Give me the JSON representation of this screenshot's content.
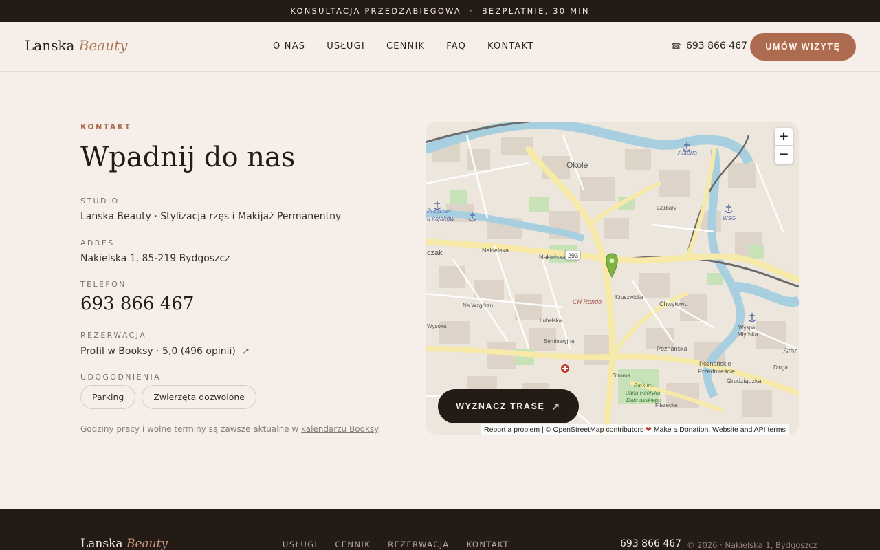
{
  "topbar": {
    "left": "KONSULTACJA PRZEDZABIEGOWA",
    "separator": "·",
    "right": "BEZPŁATNIE, 30 MIN"
  },
  "header": {
    "logo_main": "Lanska",
    "logo_accent": "Beauty",
    "nav": [
      "O NAS",
      "USŁUGI",
      "CENNIK",
      "FAQ",
      "KONTAKT"
    ],
    "phone_icon": "☎",
    "phone": "693 866 467",
    "cta": "UMÓW WIZYTĘ"
  },
  "contact": {
    "eyebrow": "KONTAKT",
    "headline": "Wpadnij do nas",
    "studio_label": "STUDIO",
    "studio_value": "Lanska Beauty · Stylizacja rzęs i Makijaż Permanentny",
    "address_label": "ADRES",
    "address_value": "Nakielska 1, 85-219 Bydgoszcz",
    "phone_label": "TELEFON",
    "phone_value": "693 866 467",
    "booking_label": "REZERWACJA",
    "booking_value": "Profil w Booksy · 5,0 (496 opinii)",
    "booking_arrow": "↗",
    "amenities_label": "UDOGODNIENIA",
    "amenities": [
      "Parking",
      "Zwierzęta dozwolone"
    ],
    "note_text": "Godziny pracy i wolne terminy są zawsze aktualne w",
    "note_link": "kalendarzu Booksy",
    "note_end": "."
  },
  "map": {
    "zoom_in": "+",
    "zoom_out": "−",
    "route_button": "WYZNACZ TRASĘ",
    "route_arrow": "↗",
    "attribution_a": "Report a problem | © OpenStreetMap contributors",
    "attribution_heart": "❤",
    "attribution_b": "Make a Donation. Website and API terms",
    "labels": {
      "okole": "Okole",
      "astoria": "Astoria",
      "przystan": "Przystań",
      "kajakow": "u kajaków",
      "czak": "czak",
      "nakielska1": "Nakielska",
      "nakielska2": "Nakielska",
      "road_293": "293",
      "ch_rondo": "CH Rondo",
      "chwytowo": "Chwytowo",
      "poznanska": "Poznańska",
      "poznanskie": "Poznańskie",
      "przedmiescie": "Przedmieście",
      "grudziadzka": "Grudziądzka",
      "park": "Park im.",
      "park2": "Jana Henryka",
      "park3": "Dąbrowskiego",
      "wyspa": "Wyspa",
      "mlynska": "Młyńska",
      "wsg": "WSG",
      "kruszwicka": "Kruszwicka",
      "wysoka": "Wysoka",
      "seminaryjna": "Seminaryjna",
      "garbary": "Garbary",
      "star": "Star",
      "dluga": "Długa",
      "filarecka": "Filarecka",
      "stroma": "Stroma",
      "lubelska": "Lubelska",
      "na_wzgorzu": "Na Wzgórzu"
    }
  },
  "footer": {
    "logo_main": "Lanska",
    "logo_accent": "Beauty",
    "nav": [
      "USŁUGI",
      "CENNIK",
      "REZERWACJA",
      "KONTAKT"
    ],
    "phone": "693 866 467",
    "copyright": "© 2026 · Nakielska 1, Bydgoszcz"
  },
  "colors": {
    "accent": "#ad6c50",
    "dark": "#241b17",
    "background": "#f6efe9",
    "map_pin": "#7cb342"
  }
}
